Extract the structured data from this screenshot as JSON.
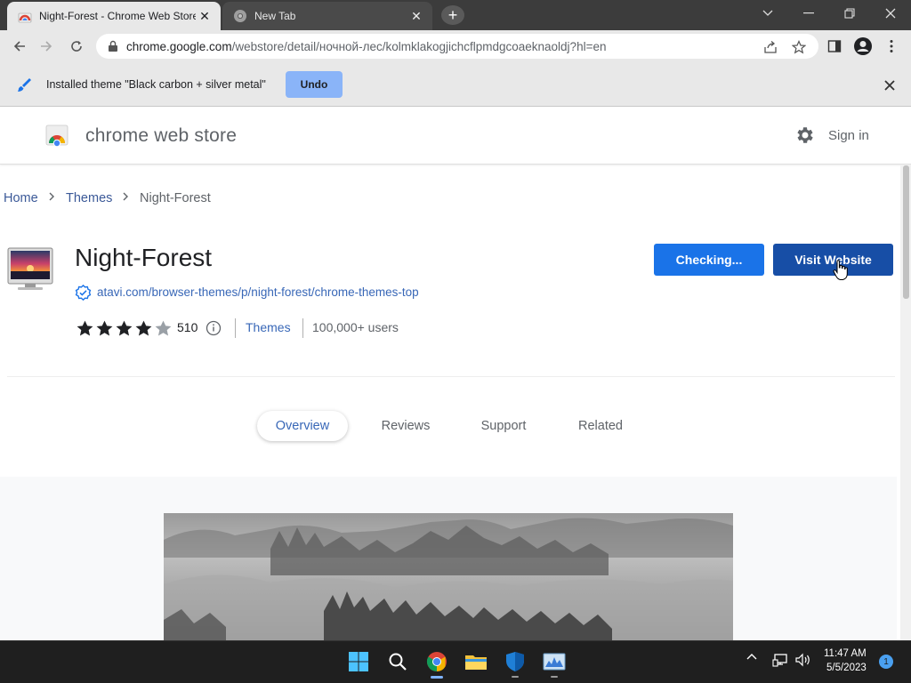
{
  "browser": {
    "tabs": [
      {
        "title": "Night-Forest - Chrome Web Store",
        "active": true
      },
      {
        "title": "New Tab",
        "active": false
      }
    ],
    "new_tab_label": "+",
    "close_glyph": "✕",
    "url_host": "chrome.google.com",
    "url_path": "/webstore/detail/ночной-лес/kolmklakogjichcflpmdgcoaeknaoldj?hl=en",
    "profile_icon": "account-circle-icon"
  },
  "infobar": {
    "message": "Installed theme \"Black carbon + silver metal\"",
    "undo_label": "Undo"
  },
  "store": {
    "name": "chrome web store",
    "signin_label": "Sign in"
  },
  "breadcrumb": {
    "home": "Home",
    "themes": "Themes",
    "current": "Night-Forest"
  },
  "item": {
    "title": "Night-Forest",
    "url": "atavi.com/browser-themes/p/night-forest/chrome-themes-top",
    "rating": 4,
    "rating_count": "510",
    "category": "Themes",
    "users": "100,000+ users",
    "checking_label": "Checking...",
    "visit_label": "Visit Website"
  },
  "content_tabs": [
    "Overview",
    "Reviews",
    "Support",
    "Related"
  ],
  "taskbar": {
    "time": "11:47 AM",
    "date": "5/5/2023",
    "notification_count": "1"
  },
  "colors": {
    "primary_blue": "#1a73e8",
    "dark_blue": "#174ea6",
    "link_blue": "#3867b7",
    "titlebar": "#3c3c3c",
    "toolbar": "#e8e8e8"
  }
}
